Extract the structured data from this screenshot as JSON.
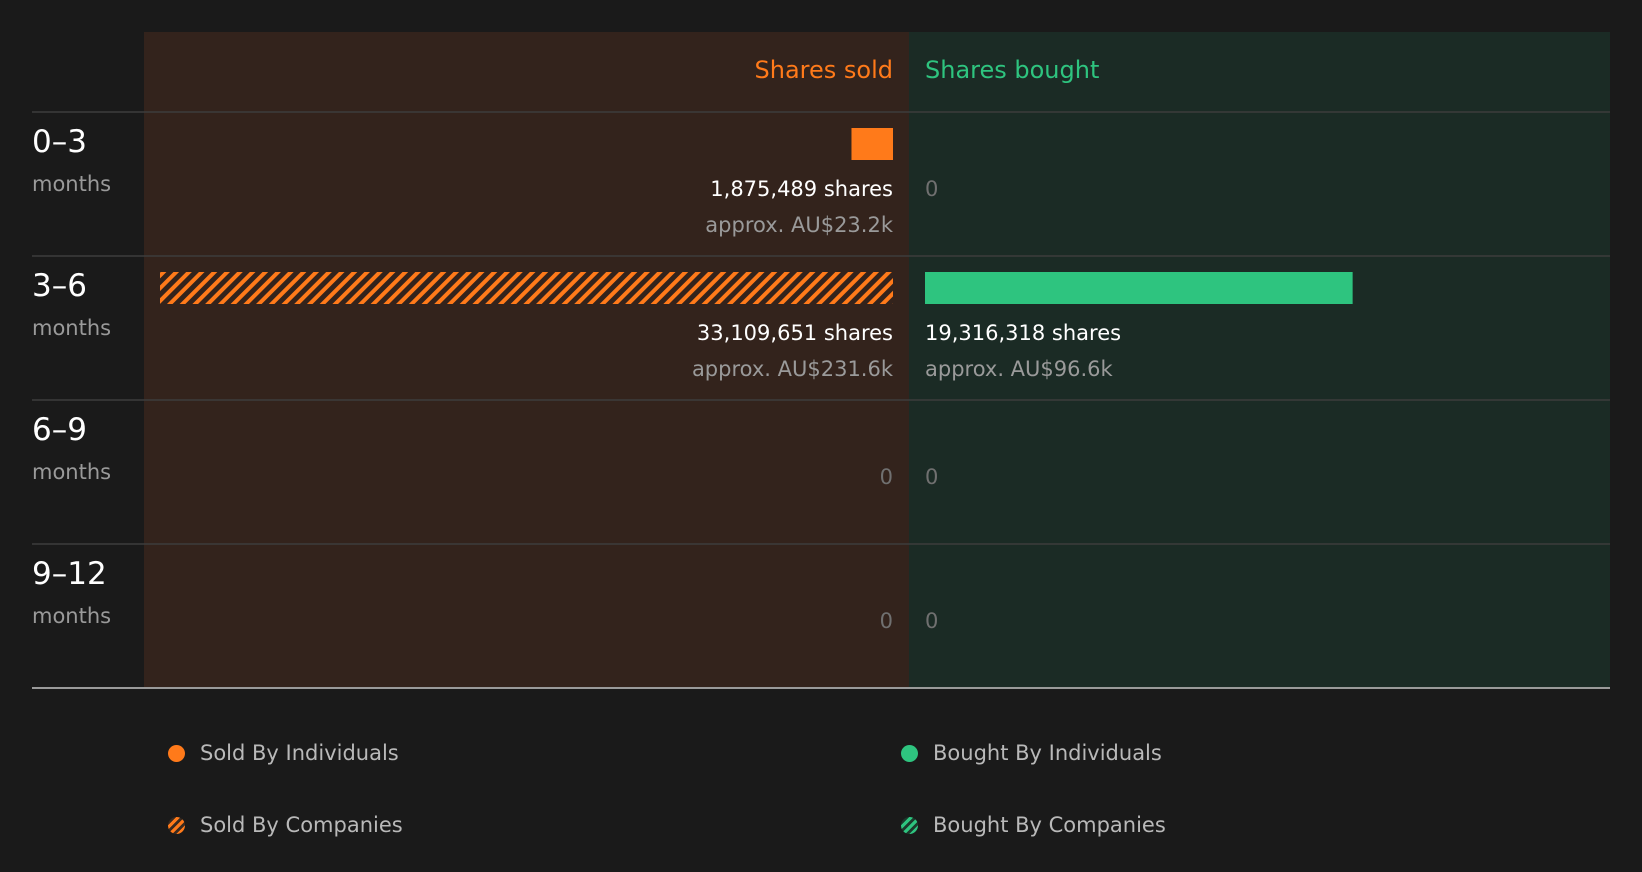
{
  "colors": {
    "background": "#1a1a1a",
    "sold_panel": "#33231c",
    "bought_panel": "#1b2b25",
    "sold": "#ff7a1a",
    "bought": "#2ec47f",
    "grid": "#3c3c3c",
    "baseline": "#9a9a9a",
    "text_main": "#ffffff",
    "text_muted": "#9a9a9a",
    "text_zero": "#707070"
  },
  "chart_data": {
    "type": "bar",
    "title": "",
    "headers": {
      "sold": "Shares sold",
      "bought": "Shares bought"
    },
    "unit_suffix": "months",
    "categories": [
      "0–3",
      "3–6",
      "6–9",
      "9–12"
    ],
    "scale_max": 33109651,
    "rows": [
      {
        "period": "0–3",
        "sold": {
          "shares": 1875489,
          "by": "individuals",
          "label": "1,875,489 shares",
          "value": "approx. AU$23.2k"
        },
        "bought": {
          "shares": 0,
          "by": "",
          "label": "0",
          "value": ""
        }
      },
      {
        "period": "3–6",
        "sold": {
          "shares": 33109651,
          "by": "companies",
          "label": "33,109,651 shares",
          "value": "approx. AU$231.6k"
        },
        "bought": {
          "shares": 19316318,
          "by": "individuals",
          "label": "19,316,318 shares",
          "value": "approx. AU$96.6k"
        }
      },
      {
        "period": "6–9",
        "sold": {
          "shares": 0,
          "by": "",
          "label": "0",
          "value": ""
        },
        "bought": {
          "shares": 0,
          "by": "",
          "label": "0",
          "value": ""
        }
      },
      {
        "period": "9–12",
        "sold": {
          "shares": 0,
          "by": "",
          "label": "0",
          "value": ""
        },
        "bought": {
          "shares": 0,
          "by": "",
          "label": "0",
          "value": ""
        }
      }
    ],
    "legend": [
      {
        "label": "Sold By Individuals",
        "style": "sold-solid"
      },
      {
        "label": "Bought By Individuals",
        "style": "bought-solid"
      },
      {
        "label": "Sold By Companies",
        "style": "sold-hatched"
      },
      {
        "label": "Bought By Companies",
        "style": "bought-hatched"
      }
    ]
  }
}
